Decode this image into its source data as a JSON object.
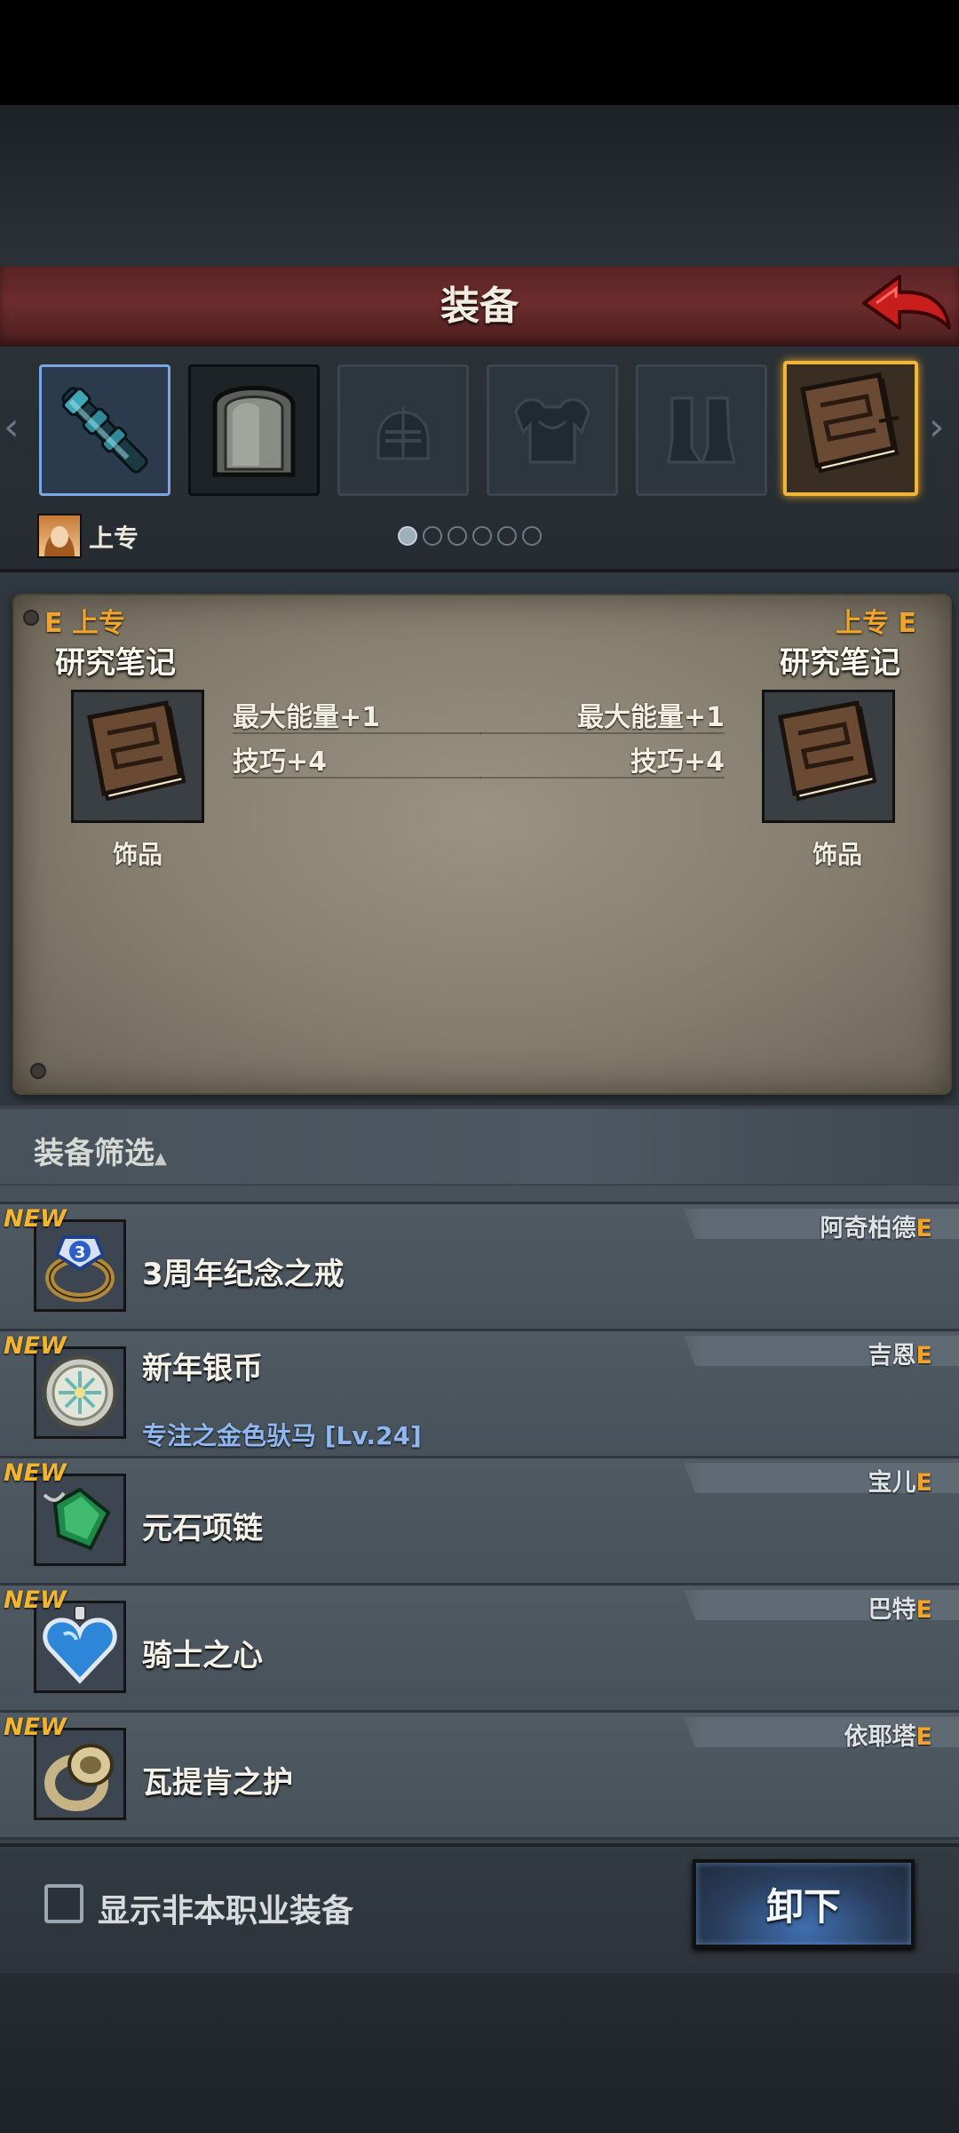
{
  "header": {
    "title": "装备"
  },
  "character": {
    "name": "上专"
  },
  "slots": [
    {
      "icon": "wand-icon",
      "state": "selected-blue"
    },
    {
      "icon": "shield-icon",
      "state": "filled"
    },
    {
      "icon": "helmet-icon",
      "state": "empty"
    },
    {
      "icon": "armor-icon",
      "state": "empty"
    },
    {
      "icon": "boots-icon",
      "state": "empty"
    },
    {
      "icon": "book-icon",
      "state": "selected-gold"
    }
  ],
  "pager": {
    "pages": 6,
    "current": 1
  },
  "compare": {
    "left": {
      "grade_label": "E 上专",
      "name": "研究笔记",
      "type": "饰品",
      "stats": [
        "最大能量+1",
        "技巧+4"
      ]
    },
    "right": {
      "grade_label": "上专 E",
      "name": "研究笔记",
      "type": "饰品",
      "stats": [
        "最大能量+1",
        "技巧+4"
      ]
    }
  },
  "filter": {
    "label": "装备筛选"
  },
  "items": [
    {
      "badge": "NEW",
      "name": "3周年纪念之戒",
      "sub": "",
      "owner": "阿奇柏德",
      "grade": "E",
      "icon": "ring-icon"
    },
    {
      "badge": "NEW",
      "name": "新年银币",
      "sub": "专注之金色驮马 [Lv.24]",
      "owner": "吉恩",
      "grade": "E",
      "icon": "coin-icon"
    },
    {
      "badge": "NEW",
      "name": "元石项链",
      "sub": "",
      "owner": "宝儿",
      "grade": "E",
      "icon": "crystal-necklace-icon"
    },
    {
      "badge": "NEW",
      "name": "骑士之心",
      "sub": "",
      "owner": "巴特",
      "grade": "E",
      "icon": "heart-pendant-icon"
    },
    {
      "badge": "NEW",
      "name": "瓦提肯之护",
      "sub": "",
      "owner": "依耶塔",
      "grade": "E",
      "icon": "gold-ring-icon"
    }
  ],
  "footer": {
    "checkbox_label": "显示非本职业装备",
    "unequip_label": "卸下"
  },
  "colors": {
    "accent_gold": "#f0a42c",
    "title_red": "#6d2c2c",
    "button_blue": "#3f6fb0"
  }
}
